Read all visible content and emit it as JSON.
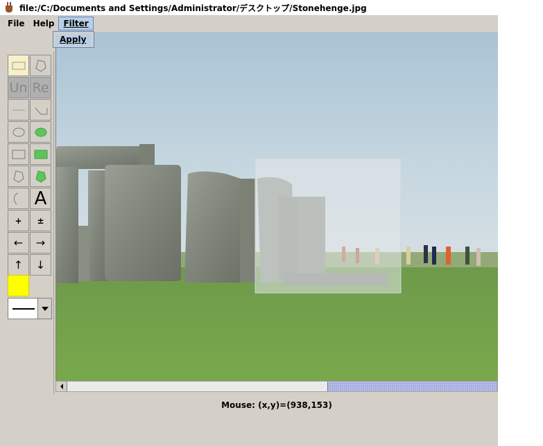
{
  "window": {
    "title": "file:/C:/Documents and Settings/Administrator/デスクトップ/Stonehenge.jpg"
  },
  "menubar": {
    "items": [
      {
        "label": "File"
      },
      {
        "label": "Help"
      },
      {
        "label": "Filter"
      }
    ]
  },
  "filter_menu": {
    "items": [
      {
        "label": "Apply"
      }
    ]
  },
  "toolbar": {
    "undo_label": "Un",
    "redo_label": "Re",
    "text_label": "A",
    "zoom_in_label": "+",
    "zoom_out_label": "±",
    "arrow_left": "←",
    "arrow_right": "→",
    "arrow_up": "↑",
    "arrow_down": "↓",
    "current_color": "#ffff00"
  },
  "status": {
    "mouse_text": "Mouse: (x,y)=(938,153)"
  },
  "colors": {
    "menu_highlight": "#b8cfe5",
    "scroll_thumb": "#9aa4d8",
    "selected_tool": "#f7f0c8"
  }
}
